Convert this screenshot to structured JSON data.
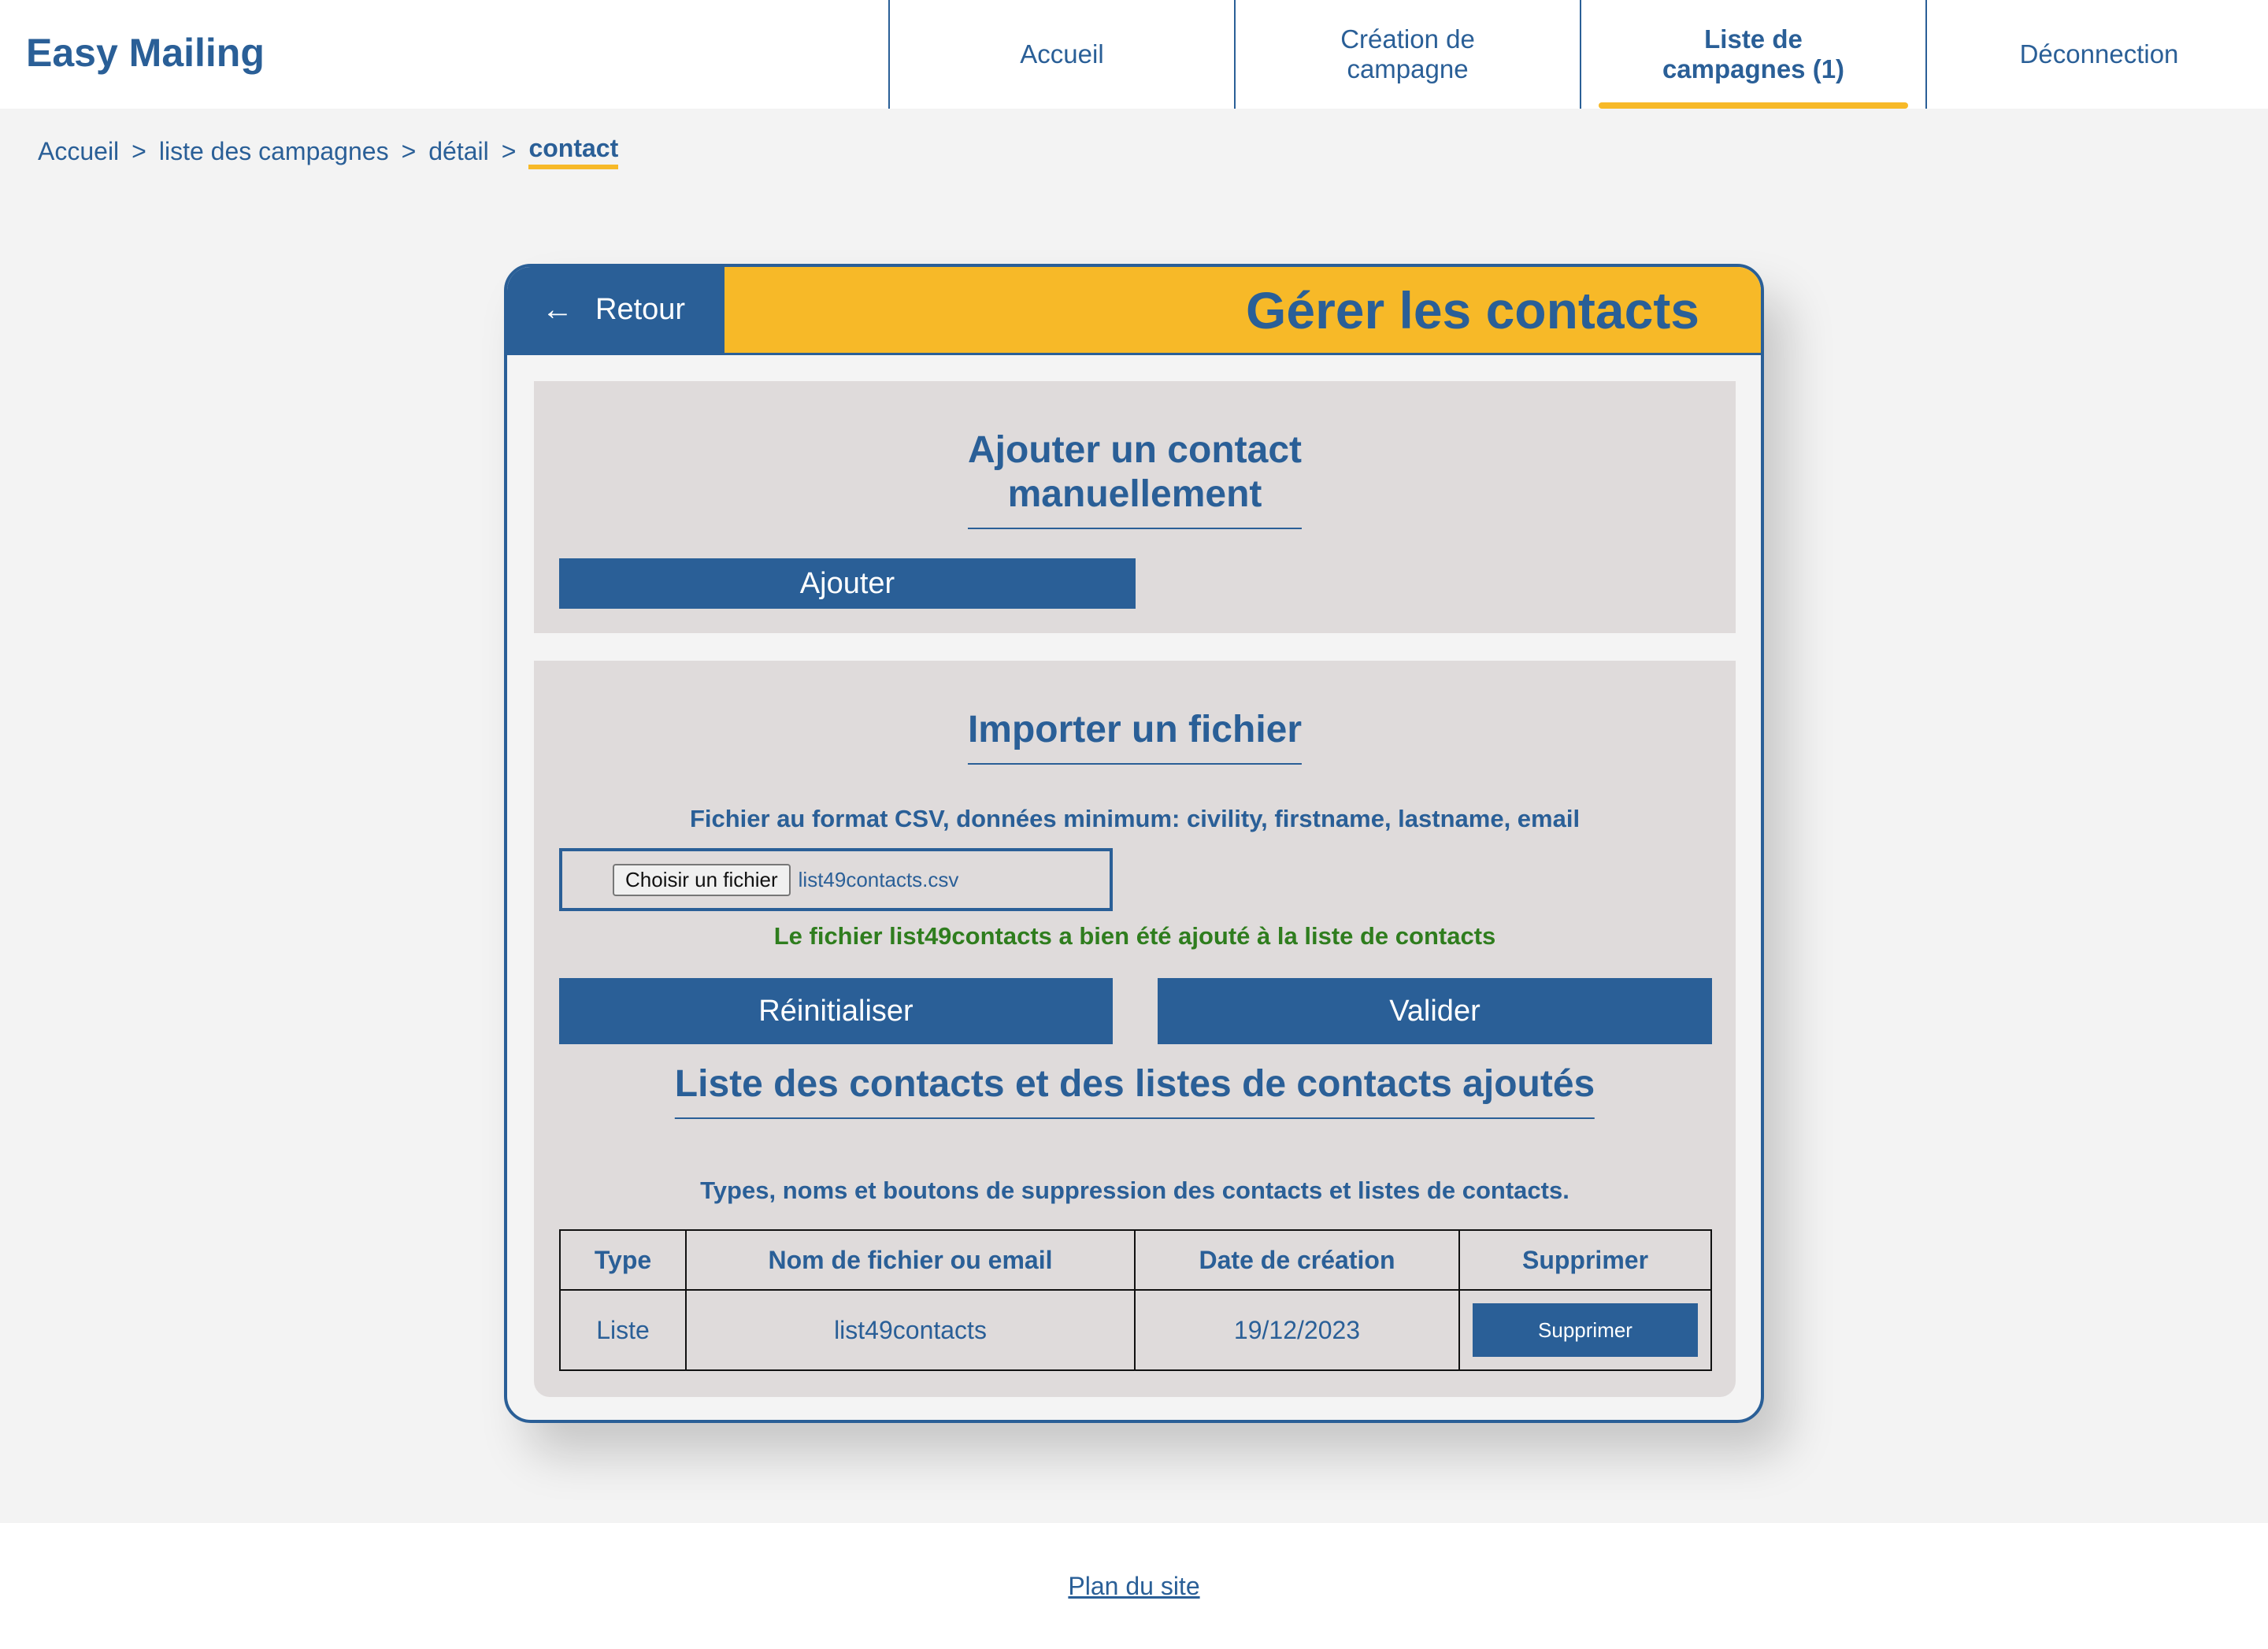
{
  "header": {
    "brand": "Easy Mailing",
    "nav": [
      {
        "label": "Accueil"
      },
      {
        "label": "Création de\ncampagne"
      },
      {
        "label": "Liste de\ncampagnes (1)"
      },
      {
        "label": "Déconnection"
      }
    ],
    "active_index": 2,
    "accent_color": "#f7b928",
    "brand_color": "#2a5f97"
  },
  "breadcrumb": {
    "items": [
      "Accueil",
      "liste des campagnes",
      "détail"
    ],
    "separator": ">",
    "current": "contact"
  },
  "card": {
    "back_label": "Retour",
    "back_icon": "arrow-left-icon",
    "title": "Gérer les contacts"
  },
  "manual": {
    "title": "Ajouter un contact\nmanuellement",
    "add_label": "Ajouter"
  },
  "import": {
    "title": "Importer un fichier",
    "hint": "Fichier au format CSV, données minimum: civility, firstname, lastname, email",
    "file_button": "Choisir un fichier",
    "file_name": "list49contacts.csv",
    "success": "Le fichier list49contacts a bien été ajouté à la liste de contacts",
    "success_color": "#2f7d1e",
    "reset_label": "Réinitialiser",
    "submit_label": "Valider"
  },
  "list": {
    "title": "Liste des contacts et des listes de contacts ajoutés",
    "caption": "Types, noms et boutons de suppression des contacts et listes de contacts.",
    "columns": [
      "Type",
      "Nom de fichier ou email",
      "Date de création",
      "Supprimer"
    ],
    "rows": [
      {
        "type": "Liste",
        "name": "list49contacts",
        "date": "19/12/2023",
        "action": "Supprimer"
      }
    ]
  },
  "footer": {
    "link": "Plan du site"
  }
}
